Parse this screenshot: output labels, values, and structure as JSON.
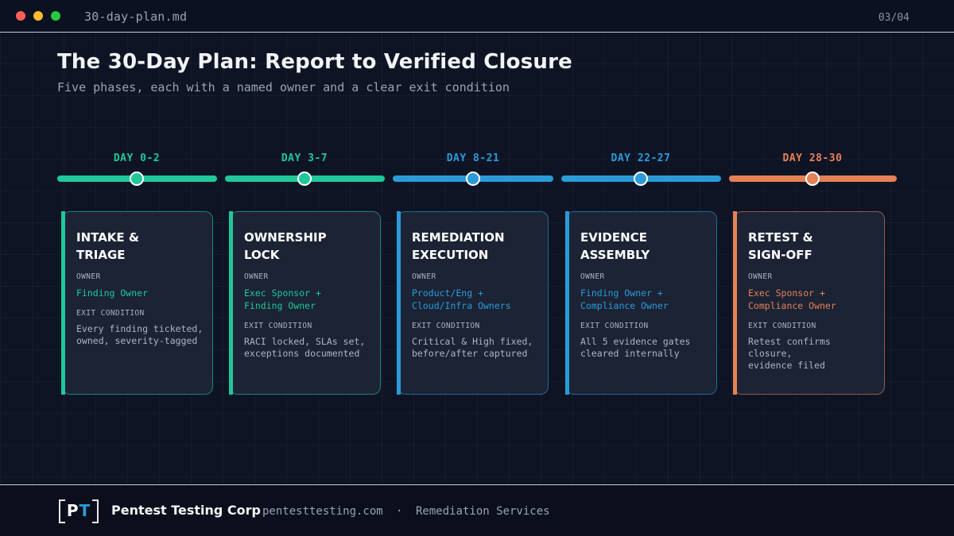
{
  "window": {
    "file_name": "30-day-plan.md",
    "page_counter": "03/04"
  },
  "heading": {
    "title": "The 30-Day Plan: Report to Verified Closure",
    "subtitle": "Five phases, each with a named owner and a clear exit condition"
  },
  "colors": {
    "green": "#1fc79a",
    "blue": "#2a9bd8",
    "orange": "#e58156"
  },
  "labels": {
    "owner": "OWNER",
    "exit_condition": "EXIT CONDITION"
  },
  "phases": [
    {
      "day": "DAY 0-2",
      "title": "INTAKE &\nTRIAGE",
      "owner": "Finding Owner",
      "exit": "Every finding ticketed,\nowned, severity-tagged",
      "color": "green"
    },
    {
      "day": "DAY 3-7",
      "title": "OWNERSHIP\nLOCK",
      "owner": "Exec Sponsor +\nFinding Owner",
      "exit": "RACI locked, SLAs set,\nexceptions documented",
      "color": "green"
    },
    {
      "day": "DAY 8-21",
      "title": "REMEDIATION\nEXECUTION",
      "owner": "Product/Eng +\nCloud/Infra Owners",
      "exit": "Critical & High fixed,\nbefore/after captured",
      "color": "blue"
    },
    {
      "day": "DAY 22-27",
      "title": "EVIDENCE\nASSEMBLY",
      "owner": "Finding Owner +\nCompliance Owner",
      "exit": "All 5 evidence gates\ncleared internally",
      "color": "blue"
    },
    {
      "day": "DAY 28-30",
      "title": "RETEST &\nSIGN-OFF",
      "owner": "Exec Sponsor +\nCompliance Owner",
      "exit": "Retest confirms\nclosure,\nevidence filed",
      "color": "orange"
    }
  ],
  "footer": {
    "logo_letters": "PT",
    "company": "Pentest Testing Corp",
    "website": "pentesttesting.com",
    "separator": "·",
    "service": "Remediation Services"
  }
}
